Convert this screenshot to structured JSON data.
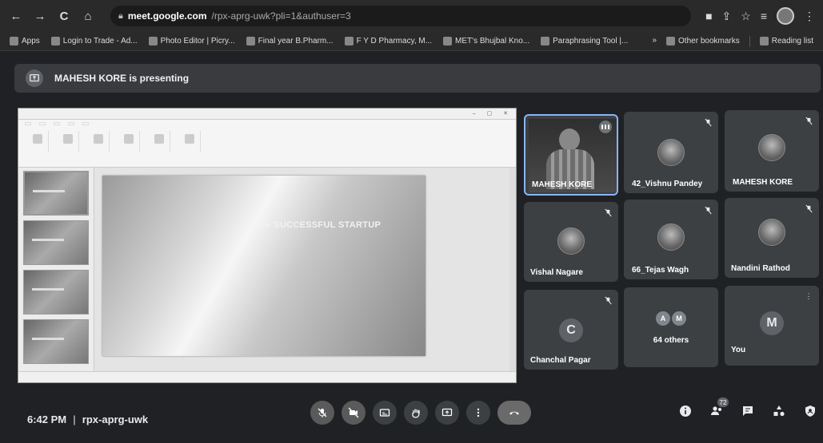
{
  "browser": {
    "url_host": "meet.google.com",
    "url_rest": "/rpx-aprg-uwk?pli=1&authuser=3",
    "bookmarks": [
      {
        "label": "Apps"
      },
      {
        "label": "Login to Trade - Ad..."
      },
      {
        "label": "Photo Editor | Picry..."
      },
      {
        "label": "Final year B.Pharm..."
      },
      {
        "label": "F Y D Pharmacy, M..."
      },
      {
        "label": "MET's Bhujbal Kno..."
      },
      {
        "label": "Paraphrasing Tool |..."
      }
    ],
    "other_bookmarks": "Other bookmarks",
    "reading_list": "Reading list"
  },
  "presenting": {
    "text": "MAHESH KORE is presenting"
  },
  "screen_share": {
    "slide_title": "OF SUCCESSFUL STARTUP"
  },
  "participants": [
    {
      "name": "MAHESH KORE",
      "kind": "video",
      "active": true
    },
    {
      "name": "42_Vishnu Pandey",
      "kind": "photo"
    },
    {
      "name": "MAHESH KORE",
      "kind": "photo"
    },
    {
      "name": "Vishal Nagare",
      "kind": "photo"
    },
    {
      "name": "66_Tejas Wagh",
      "kind": "photo"
    },
    {
      "name": "Nandini Rathod",
      "kind": "photo"
    },
    {
      "name": "Chanchal Pagar",
      "kind": "letter",
      "letter": "C"
    },
    {
      "name": "64 others",
      "kind": "group",
      "letters": [
        "A",
        "M"
      ]
    },
    {
      "name": "You",
      "kind": "letter",
      "letter": "M"
    }
  ],
  "meeting": {
    "time": "6:42 PM",
    "code": "rpx-aprg-uwk",
    "people_count": "72"
  },
  "colors": {
    "background": "#202124",
    "tile": "#3c4043",
    "active_border": "#8ab4f8"
  }
}
